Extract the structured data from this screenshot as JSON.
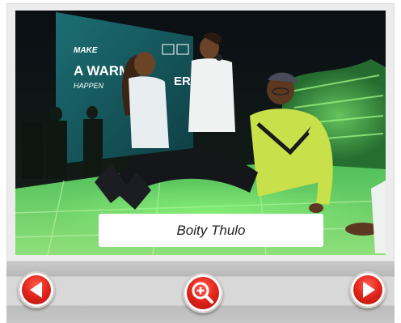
{
  "gallery": {
    "caption": "Boity Thulo",
    "photo_alt": "Boity Thulo",
    "billboard_lines": [
      "MAKE",
      "A WARM",
      "HAPPEN"
    ],
    "billboard_partial": "ER"
  },
  "controls": {
    "prev_icon": "arrow-left-icon",
    "zoom_icon": "zoom-in-icon",
    "next_icon": "arrow-right-icon",
    "accent": "#e0241a"
  }
}
